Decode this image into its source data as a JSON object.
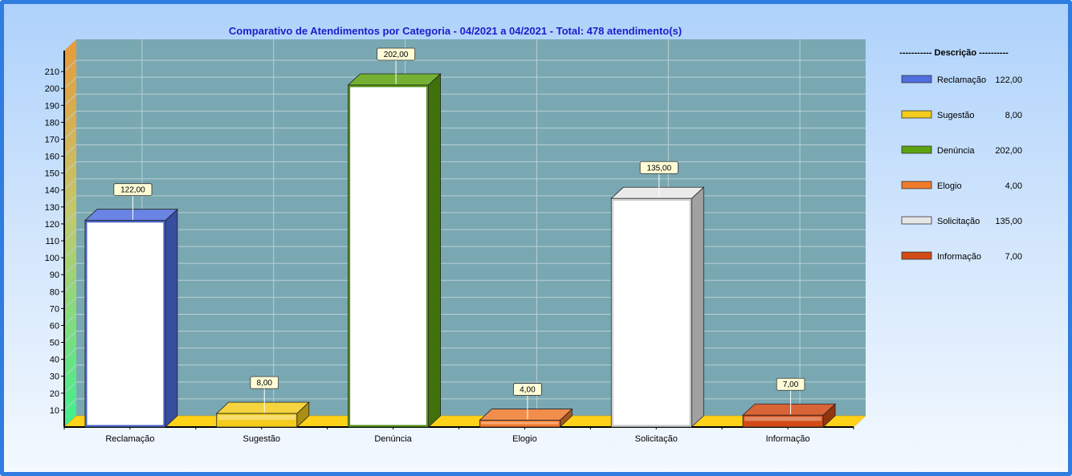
{
  "colors": {
    "wall": "#79a8b2",
    "floor": "#ffd21a",
    "grid": "#b9d0d5"
  },
  "chart_data": {
    "type": "bar",
    "title": "Comparativo  de  Atendimentos  por  Categoria  -  04/2021  a  04/2021  -  Total:  478  atendimento(s)",
    "categories": [
      "Reclamação",
      "Sugestão",
      "Denúncia",
      "Elogio",
      "Solicitação",
      "Informação"
    ],
    "values": [
      122,
      8,
      202,
      4,
      135,
      7
    ],
    "value_labels": [
      "122,00",
      "8,00",
      "202,00",
      "4,00",
      "135,00",
      "7,00"
    ],
    "colors": [
      "#4f6ee0",
      "#f3cc1d",
      "#5ca30f",
      "#f07a2c",
      "#e6e6e6",
      "#d24a14"
    ],
    "yticks": [
      "10",
      "20",
      "30",
      "40",
      "50",
      "60",
      "70",
      "80",
      "90",
      "100",
      "110",
      "120",
      "130",
      "140",
      "150",
      "160",
      "170",
      "180",
      "190",
      "200",
      "210"
    ],
    "ylim": [
      0,
      220
    ],
    "grid": true,
    "legend": {
      "title": "----------- Descrição ----------",
      "position": "right",
      "entries": [
        {
          "label": "Reclamação",
          "value": "122,00"
        },
        {
          "label": "Sugestão",
          "value": "8,00"
        },
        {
          "label": "Denúncia",
          "value": "202,00"
        },
        {
          "label": "Elogio",
          "value": "4,00"
        },
        {
          "label": "Solicitação",
          "value": "135,00"
        },
        {
          "label": "Informação",
          "value": "7,00"
        }
      ]
    }
  }
}
